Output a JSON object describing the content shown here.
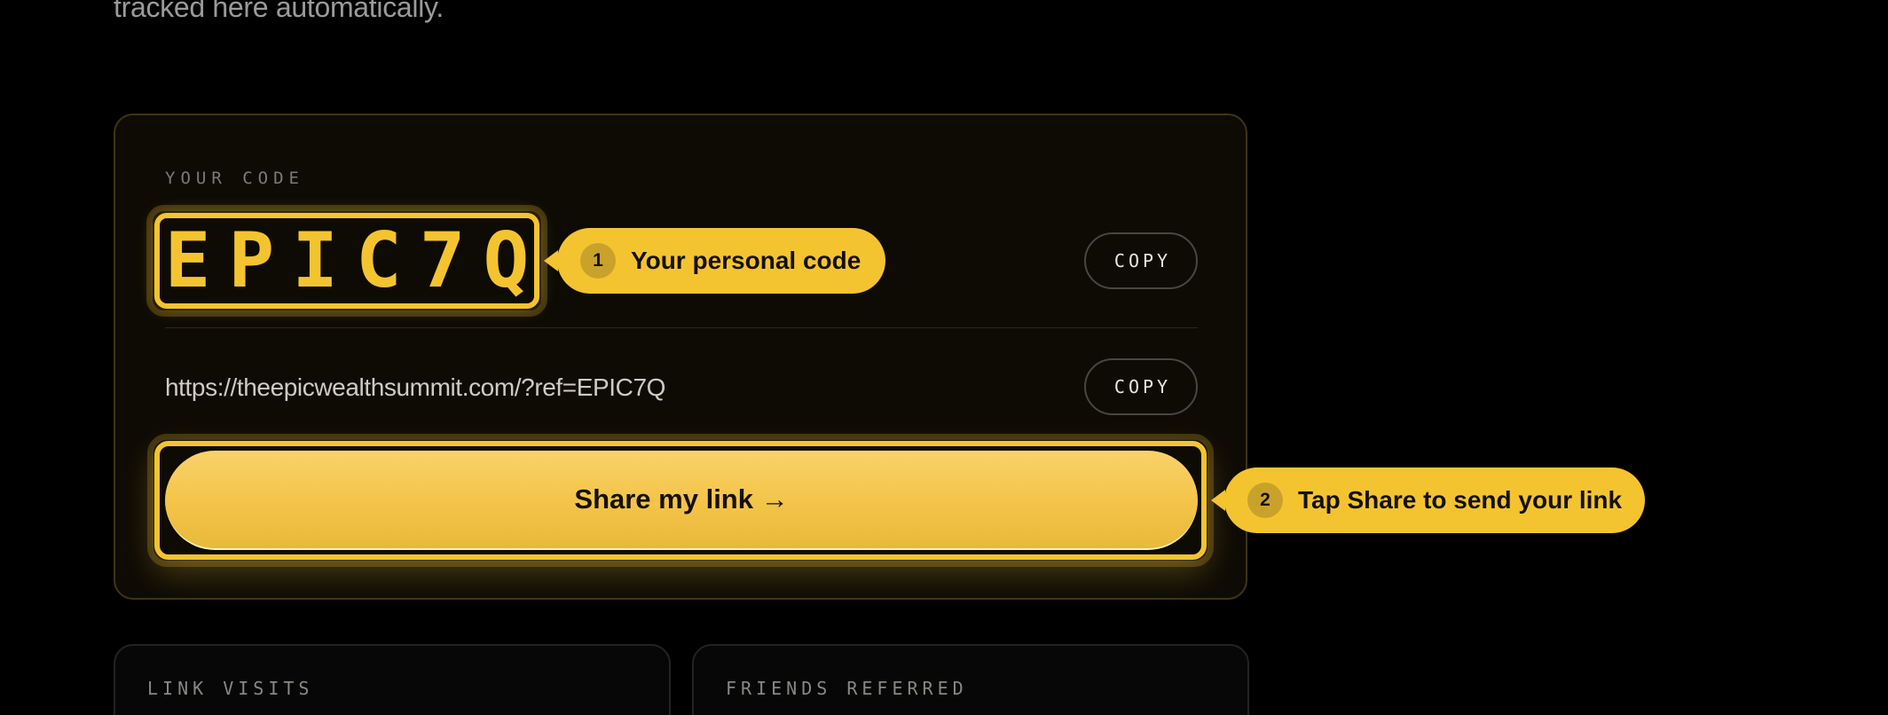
{
  "intro": {
    "text": "tracked here automatically."
  },
  "code_card": {
    "section_label": "YOUR CODE",
    "code": "EPIC7Q",
    "copy_code_label": "COPY",
    "referral_link": "https://theepicwealthsummit.com/?ref=EPIC7Q",
    "copy_link_label": "COPY",
    "share_button_label": "Share my link →"
  },
  "callouts": [
    {
      "number": "1",
      "text": "Your personal code"
    },
    {
      "number": "2",
      "text": "Tap Share to send your link"
    }
  ],
  "stats": {
    "visits_label": "LINK VISITS",
    "friends_label": "FRIENDS REFERRED"
  },
  "colors": {
    "accent": "#f4c430",
    "background": "#000000",
    "card_background": "#0e0b05"
  }
}
